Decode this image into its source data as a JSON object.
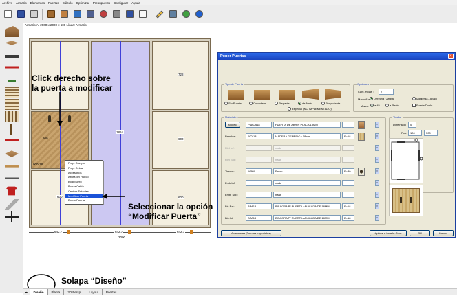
{
  "menu": [
    "Archivo",
    "Armario",
    "Elementos",
    "Puertas",
    "Cálculo",
    "Optimizar",
    "Presupuesto",
    "Configurar",
    "Ayuda"
  ],
  "info_bar": "Armario A: 2000 x 2000 x 600     Línea: Armario",
  "dims": {
    "left_top": "728",
    "center": "1864",
    "right_top": "728",
    "left_mid": "600",
    "right_mid": "600",
    "left_bottom": "600",
    "right_bottom": "600",
    "left_code": "000-18"
  },
  "bottom_dims": {
    "w1": "642.7",
    "w2": "642.7",
    "w3": "642.7",
    "total": "2000"
  },
  "context_menu": [
    "Prop. Cuerpo",
    "Prop. Celda",
    "Accesorios",
    "Altura del Hueco",
    "Bodeguero",
    "Borrar Celda",
    "Centrar Estantes",
    "Modificar Puerta",
    "Borrar Puerta"
  ],
  "context_selected": "Modificar Puerta",
  "annotations": {
    "click": "Click derecho sobre\nla puerta a modificar",
    "select": "Seleccionar la opción\n“Modificar Puerta”",
    "tab": "Solapa “Diseño”"
  },
  "dialog": {
    "title": "Poner Puertas",
    "tipo_group": "Tipo de Puerta",
    "tipo_radios": [
      "Sin Puerta",
      "Corredera",
      "Plegable",
      "de Abrir",
      "Proyectante"
    ],
    "tipo_selected": "de Abrir",
    "especial": "Especial (NO IMPLEMENTADO)",
    "opciones_group": "Opciones",
    "cant_hojas_label": "Cant. Hojas :",
    "cant_hojas_value": "2",
    "mano_label": "Mano Abre",
    "mano_options": [
      "Derecha / Arriba",
      "Izquierda / Abajo"
    ],
    "puerta_doble": "Puerta Doble",
    "marco_label": "Marco:",
    "marco_options": [
      "a 45",
      "a Recto"
    ],
    "materiales_group": "Materiales",
    "modelo_btn": "Modelo",
    "rows": [
      {
        "label": "Modelo",
        "code": "PLACA18",
        "desc": "PUERTA DE ABRIR PLACA 18MM",
        "extra": ""
      },
      {
        "label": "Paneles:",
        "code": "000-18",
        "desc": "MADERA GENERICA 18mm",
        "extra": "E=18"
      },
      {
        "label": "Riel Inf:",
        "code": "",
        "desc": "nada",
        "extra": ""
      },
      {
        "label": "Riel Sup:",
        "code": "",
        "desc": "nada",
        "extra": ""
      },
      {
        "label": "Tirador:",
        "code": "16800",
        "desc": "Paton",
        "extra": "E=30"
      },
      {
        "label": "Emb.Inf:",
        "code": "",
        "desc": "nada",
        "extra": ""
      },
      {
        "label": "Emb. Sup:",
        "code": "",
        "desc": "nada",
        "extra": ""
      },
      {
        "label": "Bis.Ext:",
        "code": "BPA18",
        "desc": "BISAGRA P/ PUERTA APLICADA DE 18MM",
        "extra": "E=18"
      },
      {
        "label": "Bis.Int:",
        "code": "BPA18",
        "desc": "BISAGRA P/ PUERTA APLICADA DE 18MM",
        "extra": "E=18"
      }
    ],
    "tirador_group": "Tirador",
    "dimension_label": "Dimensión :",
    "dimension_value": "0",
    "pos_label": "Pos:",
    "pos_value1": "100",
    "pos_value2": "500",
    "avanzadas_btn": "Avanzadas (Puertas especiales)",
    "aplicar_btn": "Aplicar a toda la Obra",
    "ok_btn": "OK",
    "cancel_btn": "Cancel"
  },
  "tabs": [
    "Diseño",
    "Planta",
    "3D Persp.",
    "Layout",
    "Puertas"
  ],
  "active_tab": "Diseño",
  "colors": {
    "accent": "#1a52d8",
    "door_blue": "#ccc8f2",
    "wood": "#c9a46e",
    "title": "#2a68e8"
  }
}
